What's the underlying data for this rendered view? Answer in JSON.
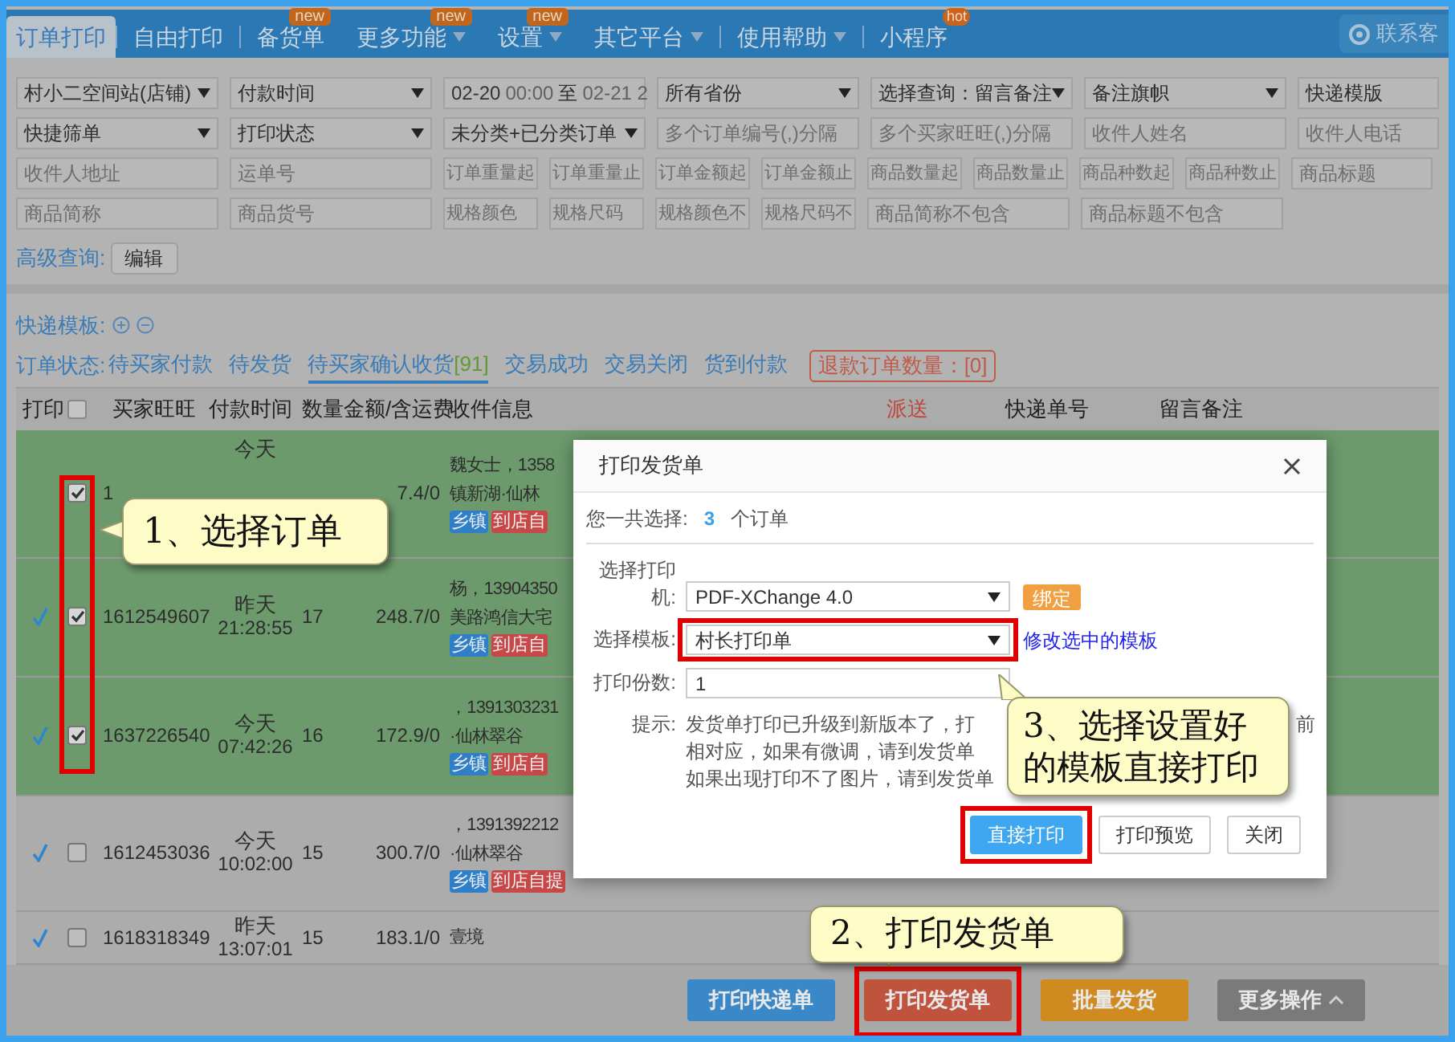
{
  "nav": {
    "tabs": [
      {
        "label": "订单打印",
        "selected": true,
        "separator": true
      },
      {
        "label": "自由打印",
        "selected": false,
        "separator": true
      },
      {
        "label": "备货单",
        "selected": false,
        "badge": "new"
      },
      {
        "label": "更多功能",
        "selected": false,
        "badge": "new",
        "dropdown": true
      },
      {
        "label": "设置",
        "selected": false,
        "badge": "new",
        "dropdown": true
      },
      {
        "label": "其它平台",
        "selected": false,
        "dropdown": true,
        "separator": true
      },
      {
        "label": "使用帮助",
        "selected": false,
        "dropdown": true,
        "separator": true
      },
      {
        "label": "小程序",
        "selected": false,
        "badge": "hot"
      }
    ],
    "contact": "联系客"
  },
  "filters": {
    "fields": [
      {
        "kind": "select",
        "value": "村小二空间站(店铺)"
      },
      {
        "kind": "select",
        "value": "付款时间"
      },
      {
        "kind": "daterange",
        "start_date": "02-20",
        "start_time": "00:00",
        "separator": "至",
        "end": "02-21 2"
      },
      {
        "kind": "select",
        "value": "所有省份"
      },
      {
        "kind": "select",
        "value": "选择查询：留言备注"
      },
      {
        "kind": "select",
        "value": "备注旗帜"
      },
      {
        "kind": "compact",
        "value": "快递模版"
      },
      {
        "kind": "select",
        "value": "快捷筛单"
      },
      {
        "kind": "select",
        "value": "打印状态"
      },
      {
        "kind": "select",
        "value": "未分类+已分类订单"
      },
      {
        "kind": "input",
        "placeholder": "多个订单编号(,)分隔"
      },
      {
        "kind": "input",
        "placeholder": "多个买家旺旺(,)分隔"
      },
      {
        "kind": "input",
        "placeholder": "收件人姓名"
      },
      {
        "kind": "compact",
        "placeholder": "收件人电话"
      },
      {
        "kind": "input",
        "placeholder": "收件人地址"
      },
      {
        "kind": "input",
        "placeholder": "运单号"
      },
      {
        "kind": "short",
        "placeholder": "订单重量起"
      },
      {
        "kind": "short",
        "placeholder": "订单重量止"
      },
      {
        "kind": "short",
        "placeholder": "订单金额起"
      },
      {
        "kind": "short",
        "placeholder": "订单金额止"
      },
      {
        "kind": "short",
        "placeholder": "商品数量起"
      },
      {
        "kind": "short",
        "placeholder": "商品数量止"
      },
      {
        "kind": "short",
        "placeholder": "商品种数起"
      },
      {
        "kind": "short",
        "placeholder": "商品种数止"
      },
      {
        "kind": "compact",
        "placeholder": "商品标题"
      },
      {
        "kind": "input",
        "placeholder": "商品简称"
      },
      {
        "kind": "input",
        "placeholder": "商品货号"
      },
      {
        "kind": "short",
        "placeholder": "规格颜色"
      },
      {
        "kind": "short",
        "placeholder": "规格尺码"
      },
      {
        "kind": "short",
        "placeholder": "规格颜色不"
      },
      {
        "kind": "short",
        "placeholder": "规格尺码不"
      },
      {
        "kind": "input",
        "placeholder": "商品简称不包含"
      },
      {
        "kind": "input",
        "placeholder": "商品标题不包含"
      }
    ],
    "advanced_label": "高级查询:",
    "advanced_button": "编辑"
  },
  "template_label": "快递模板:",
  "status": {
    "label": "订单状态:",
    "tabs": [
      {
        "label": "待买家付款",
        "selected": false
      },
      {
        "label": "待发货",
        "selected": false
      },
      {
        "label": "待买家确认收货",
        "count": "[91]",
        "selected": true
      },
      {
        "label": "交易成功",
        "selected": false
      },
      {
        "label": "交易关闭",
        "selected": false
      },
      {
        "label": "货到付款",
        "selected": false
      }
    ],
    "refund": "退款订单数量：[0]"
  },
  "table": {
    "columns": [
      "打印",
      "买家旺旺",
      "付款时间",
      "数量",
      "金额/含运费",
      "收件信息",
      "派送",
      "快递单号",
      "留言备注"
    ],
    "select_all_checked": false,
    "rows": [
      {
        "printed": false,
        "checked": true,
        "selected": true,
        "buyer": "1",
        "day": "今天",
        "amount": "7.4/0",
        "address": [
          "魏女士，1358",
          "镇新湖·仙林"
        ],
        "tags": [
          {
            "label": "乡镇",
            "color": "#2f7fc8"
          },
          {
            "label": "到店自",
            "color": "#c84848"
          }
        ]
      },
      {
        "printed": true,
        "checked": true,
        "selected": true,
        "buyer": "1612549607",
        "day": "昨天",
        "time": "21:28:55",
        "qty": "17",
        "amount": "248.7/0",
        "address": [
          "杨，13904350",
          "美路鸿信大宅"
        ],
        "tags": [
          {
            "label": "乡镇",
            "color": "#2f7fc8"
          },
          {
            "label": "到店自",
            "color": "#c84848"
          }
        ]
      },
      {
        "printed": true,
        "checked": true,
        "selected": true,
        "buyer": "1637226540",
        "day": "今天",
        "time": "07:42:26",
        "qty": "16",
        "amount": "172.9/0",
        "address": [
          "，1391303231",
          "·仙林翠谷"
        ],
        "tags": [
          {
            "label": "乡镇",
            "color": "#2f7fc8"
          },
          {
            "label": "到店自",
            "color": "#c84848"
          }
        ]
      },
      {
        "printed": true,
        "checked": false,
        "selected": false,
        "buyer": "1612453036",
        "day": "今天",
        "time": "10:02:00",
        "qty": "15",
        "amount": "300.7/0",
        "address": [
          "，1391392212",
          "·仙林翠谷"
        ],
        "tags": [
          {
            "label": "乡镇",
            "color": "#2f7fc8"
          },
          {
            "label": "到店自提",
            "color": "#c84848"
          }
        ]
      },
      {
        "printed": true,
        "checked": false,
        "selected": false,
        "buyer": "1618318349",
        "day": "昨天",
        "time": "13:07:01",
        "qty": "15",
        "amount": "183.1/0",
        "address": [
          "壹境"
        ],
        "tags": []
      }
    ]
  },
  "dialog": {
    "title": "打印发货单",
    "summary_label": "您一共选择:",
    "summary_count": "3",
    "summary_unit": "个订单",
    "printer_label": "选择打印机:",
    "printer": "PDF-XChange 4.0",
    "bind_button": "绑定",
    "template_label": "选择模板:",
    "template": "村长打印单",
    "template_link": "修改选中的模板",
    "copies_label": "打印份数:",
    "copies": "1",
    "hint_label": "提示:",
    "hint_lines": [
      {
        "text": "发货单打印已升级到新版本了，打",
        "tail": "前"
      },
      {
        "text": "相对应，如果有微调，请到发货单"
      },
      {
        "text": "如果出现打印不了图片，请到发货单"
      }
    ],
    "buttons": [
      {
        "label": "直接打印",
        "kind": "primary"
      },
      {
        "label": "打印预览",
        "kind": "default"
      },
      {
        "label": "关闭",
        "kind": "default"
      }
    ]
  },
  "actions": [
    {
      "label": "打印快递单",
      "color": "#3a88c8"
    },
    {
      "label": "打印发货单",
      "color": "#c0533e"
    },
    {
      "label": "批量发货",
      "color": "#cf8a20"
    },
    {
      "label": "更多操作",
      "color": "#7a7a7a",
      "dropdown": true
    }
  ],
  "callouts": [
    "1、选择订单",
    "2、打印发货单",
    "3、选择设置好的模板直接打印"
  ]
}
